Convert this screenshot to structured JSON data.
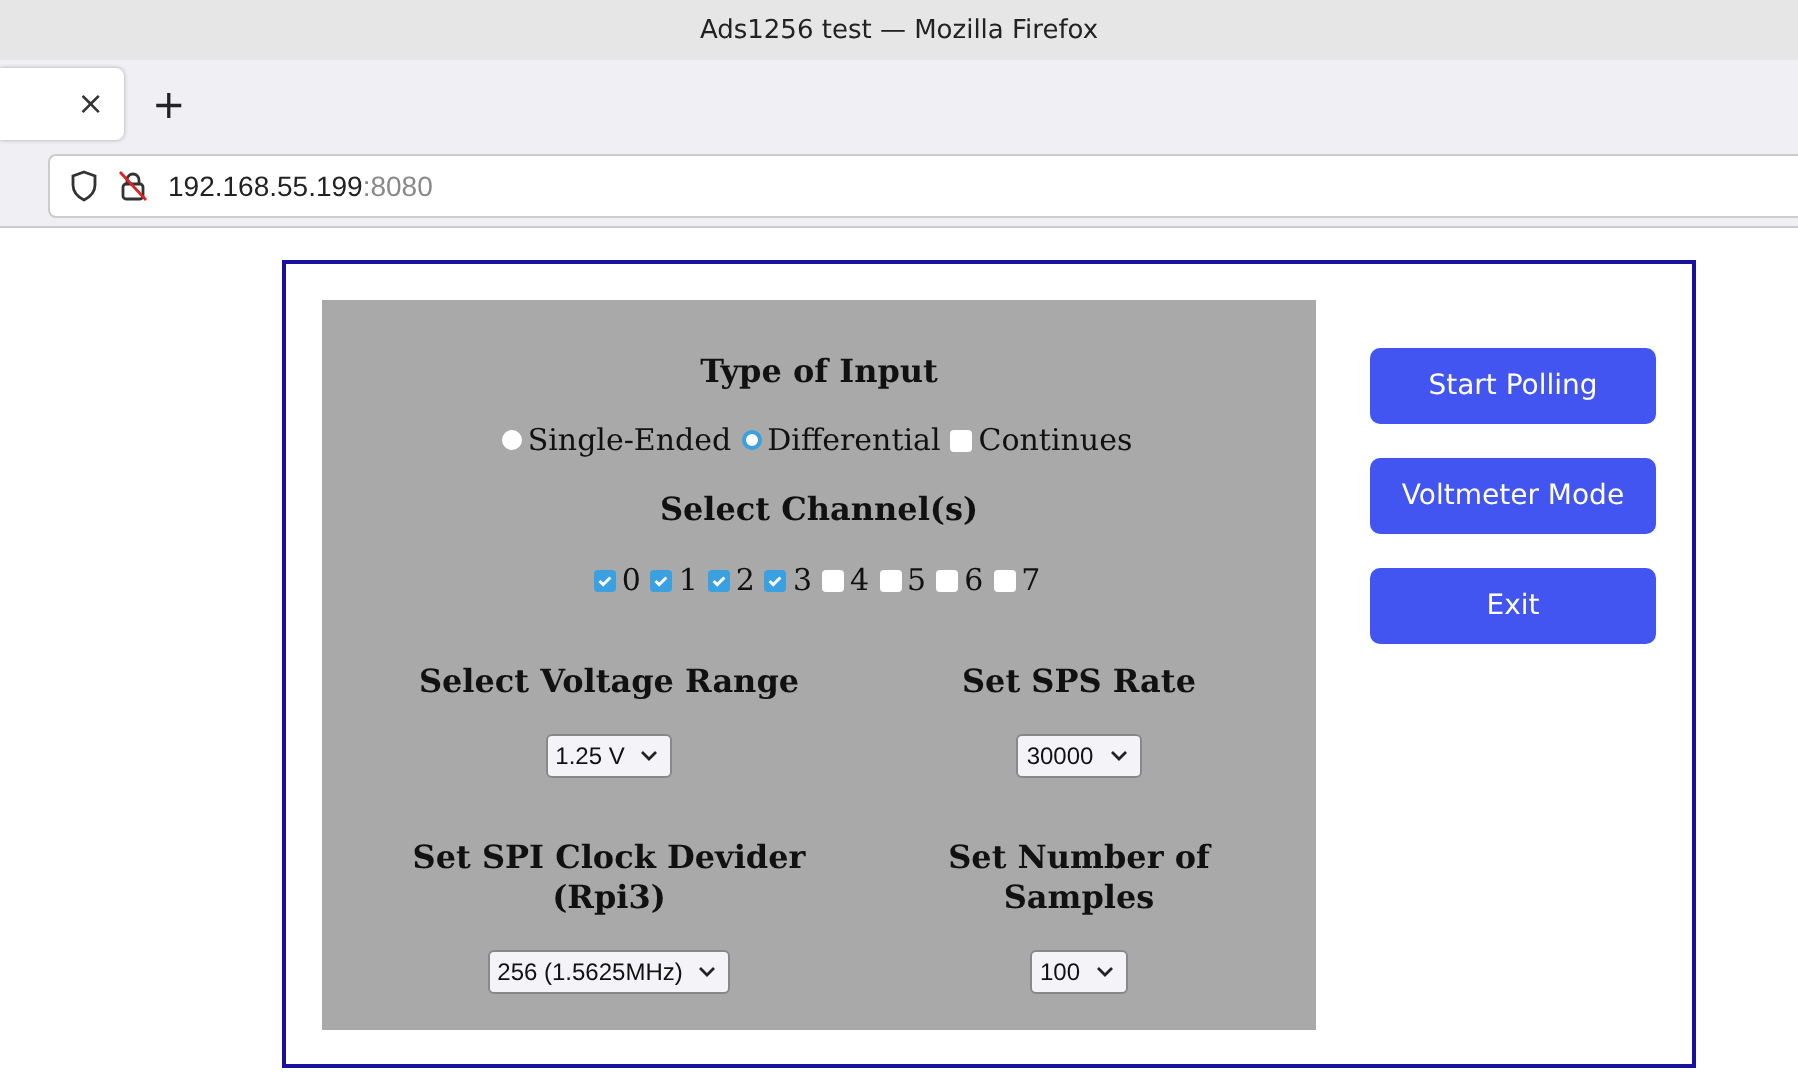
{
  "window": {
    "title": "Ads1256 test — Mozilla Firefox"
  },
  "tab": {
    "close": "×",
    "new_tab": "+"
  },
  "address": {
    "host": "192.168.55.199",
    "port": ":8080"
  },
  "input_type": {
    "heading": "Type of Input",
    "options": [
      {
        "kind": "radio",
        "label": "Single-Ended",
        "selected": false
      },
      {
        "kind": "radio",
        "label": "Differential",
        "selected": true
      },
      {
        "kind": "checkbox",
        "label": "Continues",
        "checked": false
      }
    ]
  },
  "channels": {
    "heading": "Select Channel(s)",
    "items": [
      {
        "label": "0",
        "checked": true
      },
      {
        "label": "1",
        "checked": true
      },
      {
        "label": "2",
        "checked": true
      },
      {
        "label": "3",
        "checked": true
      },
      {
        "label": "4",
        "checked": false
      },
      {
        "label": "5",
        "checked": false
      },
      {
        "label": "6",
        "checked": false
      },
      {
        "label": "7",
        "checked": false
      }
    ]
  },
  "settings": [
    {
      "heading": "Select Voltage Range",
      "value": "1.25 V"
    },
    {
      "heading": "Set SPS Rate",
      "value": "30000"
    },
    {
      "heading": "Set SPI Clock Devider (Rpi3)",
      "value": "256 (1.5625MHz)"
    },
    {
      "heading": "Set Number of Samples",
      "value": "100"
    }
  ],
  "buttons": [
    "Start Polling",
    "Voltmeter Mode",
    "Exit"
  ]
}
